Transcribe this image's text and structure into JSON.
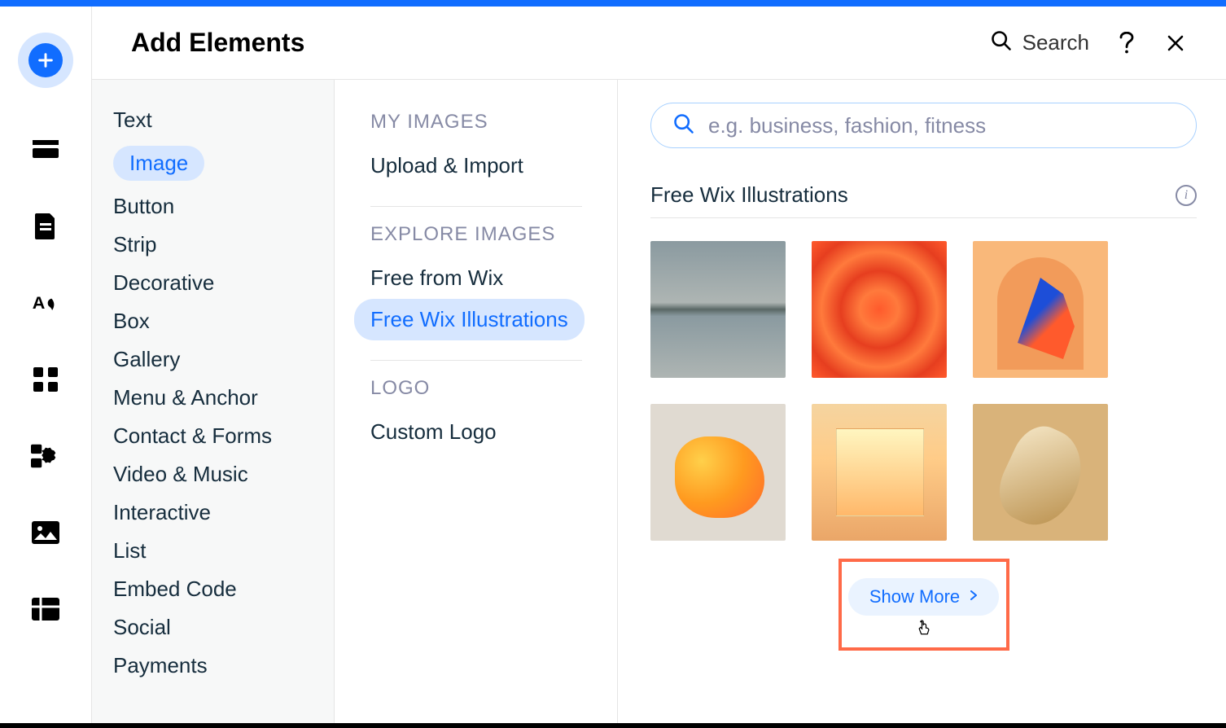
{
  "panel": {
    "title": "Add Elements",
    "searchLabel": "Search"
  },
  "col1": [
    "Text",
    "Image",
    "Button",
    "Strip",
    "Decorative",
    "Box",
    "Gallery",
    "Menu & Anchor",
    "Contact & Forms",
    "Video & Music",
    "Interactive",
    "List",
    "Embed Code",
    "Social",
    "Payments"
  ],
  "col1ActiveIndex": 1,
  "col2": {
    "sections": [
      {
        "header": "MY IMAGES",
        "items": [
          "Upload & Import"
        ]
      },
      {
        "header": "EXPLORE IMAGES",
        "items": [
          "Free from Wix",
          "Free Wix Illustrations"
        ]
      },
      {
        "header": "LOGO",
        "items": [
          "Custom Logo"
        ]
      }
    ],
    "activeItem": "Free Wix Illustrations"
  },
  "col3": {
    "searchPlaceholder": "e.g. business, fashion, fitness",
    "sectionTitle": "Free Wix Illustrations",
    "showMore": "Show More"
  }
}
